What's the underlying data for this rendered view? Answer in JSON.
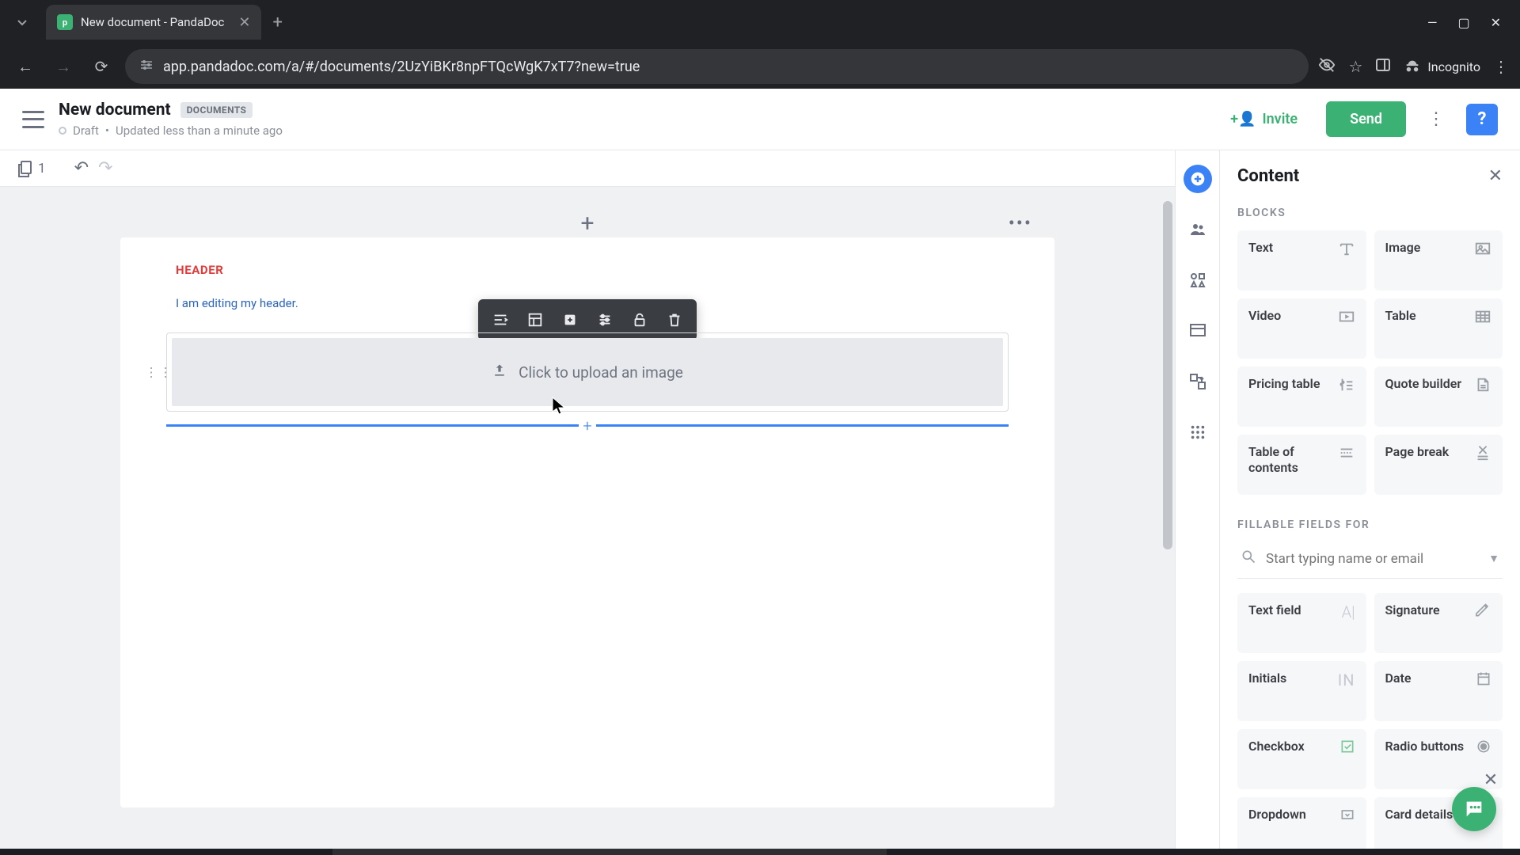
{
  "browser": {
    "tab_title": "New document - PandaDoc",
    "url": "app.pandadoc.com/a/#/documents/2UzYiBKr8npFTQcWgK7xT7?new=true",
    "incognito_label": "Incognito"
  },
  "header": {
    "title": "New document",
    "chip": "DOCUMENTS",
    "status": "Draft",
    "updated": "Updated less than a minute ago",
    "invite": "Invite",
    "send": "Send"
  },
  "toolbar": {
    "page_count": "1"
  },
  "document": {
    "header_label": "HEADER",
    "header_text": "I am editing my header.",
    "upload_prompt": "Click to upload an image"
  },
  "panel": {
    "title": "Content",
    "blocks_label": "BLOCKS",
    "fields_label": "FILLABLE FIELDS FOR",
    "search_placeholder": "Start typing name or email",
    "blocks": {
      "text": "Text",
      "image": "Image",
      "video": "Video",
      "table": "Table",
      "pricing": "Pricing table",
      "quote": "Quote builder",
      "toc": "Table of contents",
      "pagebreak": "Page break"
    },
    "fields": {
      "textfield": "Text field",
      "signature": "Signature",
      "initials": "Initials",
      "date": "Date",
      "checkbox": "Checkbox",
      "radio": "Radio buttons",
      "dropdown": "Dropdown",
      "card": "Card details"
    }
  }
}
